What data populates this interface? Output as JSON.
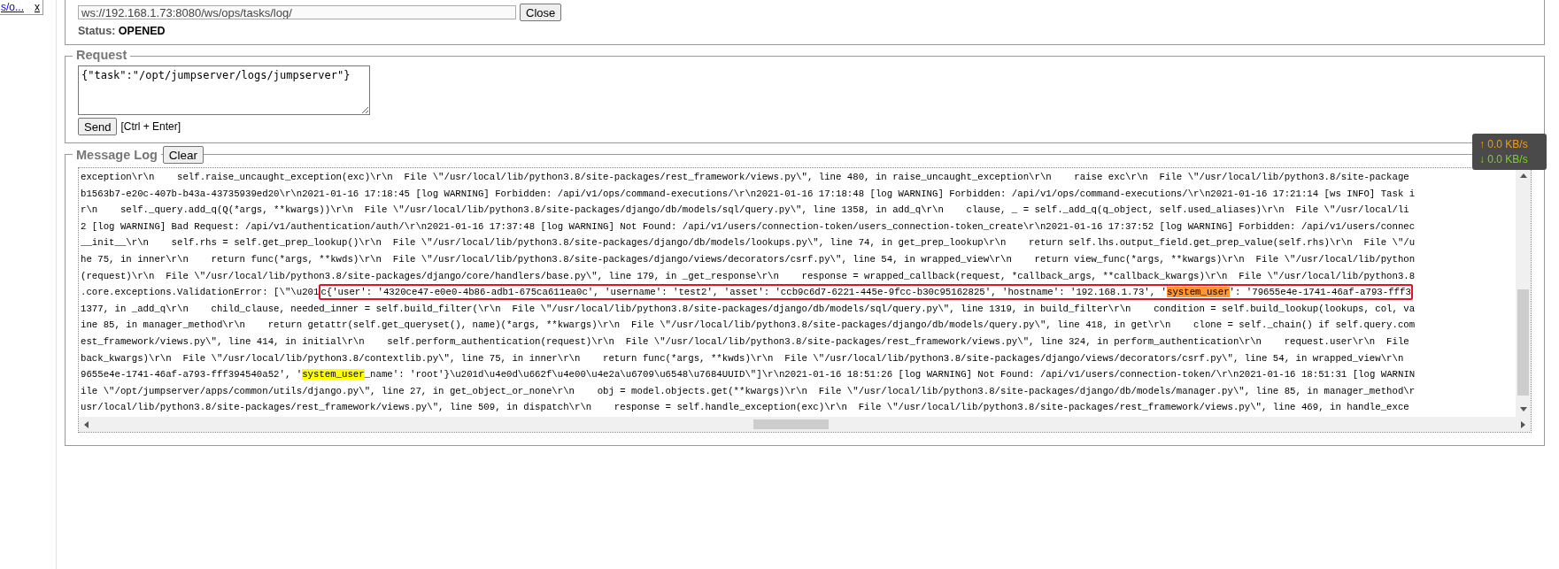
{
  "sidebar": {
    "link": "s/o...",
    "close": "x"
  },
  "connection": {
    "url": "ws://192.168.1.73:8080/ws/ops/tasks/log/",
    "button": "Close",
    "status_label": "Status:",
    "status": "OPENED"
  },
  "request": {
    "legend": "Request",
    "value": "{\"task\":\"/opt/jumpserver/logs/jumpserver\"}",
    "button": "Send",
    "hint": "[Ctrl + Enter]"
  },
  "message_log": {
    "legend": "Message Log",
    "button": "Clear",
    "lines": [
      [
        {
          "text": "exception\\r\\n    self.raise_uncaught_exception(exc)\\r\\n  File \\\"/usr/local/lib/python3.8/site-packages/rest_framework/views.py\\\", line 480, in raise_uncaught_exception\\r\\n    raise exc\\r\\n  File \\\"/usr/local/lib/python3.8/site-package"
        }
      ],
      [
        {
          "text": "b1563b7-e20c-407b-b43a-43735939ed20\\r\\n2021-01-16 17:18:45 [log WARNING] Forbidden: /api/v1/ops/command-executions/\\r\\n2021-01-16 17:18:48 [log WARNING] Forbidden: /api/v1/ops/command-executions/\\r\\n2021-01-16 17:21:14 [ws INFO] Task i"
        }
      ],
      [
        {
          "text": "r\\n    self._query.add_q(Q(*args, **kwargs))\\r\\n  File \\\"/usr/local/lib/python3.8/site-packages/django/db/models/sql/query.py\\\", line 1358, in add_q\\r\\n    clause, _ = self._add_q(q_object, self.used_aliases)\\r\\n  File \\\"/usr/local/li"
        }
      ],
      [
        {
          "text": "2 [log WARNING] Bad Request: /api/v1/authentication/auth/\\r\\n2021-01-16 17:37:48 [log WARNING] Not Found: /api/v1/users/connection-token/users_connection-token_create\\r\\n2021-01-16 17:37:52 [log WARNING] Forbidden: /api/v1/users/connec"
        }
      ],
      [
        {
          "text": "__init__\\r\\n    self.rhs = self.get_prep_lookup()\\r\\n  File \\\"/usr/local/lib/python3.8/site-packages/django/db/models/lookups.py\\\", line 74, in get_prep_lookup\\r\\n    return self.lhs.output_field.get_prep_value(self.rhs)\\r\\n  File \\\"/u"
        }
      ],
      [
        {
          "text": "he 75, in inner\\r\\n    return func(*args, **kwds)\\r\\n  File \\\"/usr/local/lib/python3.8/site-packages/django/views/decorators/csrf.py\\\", line 54, in wrapped_view\\r\\n    return view_func(*args, **kwargs)\\r\\n  File \\\"/usr/local/lib/python"
        }
      ],
      [
        {
          "text": "(request)\\r\\n  File \\\"/usr/local/lib/python3.8/site-packages/django/core/handlers/base.py\\\", line 179, in _get_response\\r\\n    response = wrapped_callback(request, *callback_args, **callback_kwargs)\\r\\n  File \\\"/usr/local/lib/python3.8"
        }
      ],
      [
        {
          "text": ".core.exceptions.ValidationError: [\\\"\\u201"
        },
        {
          "kind": "outlined",
          "parts": [
            {
              "text": "c{'user': '4320ce47-e0e0-4b86-adb1-675ca611ea0c', 'username': 'test2', 'asset': 'ccb9c6d7-6221-445e-9fcc-b30c95162825', 'hostname': '192.168.1.73', '"
            },
            {
              "text": "system_user",
              "color": "#ff9632"
            },
            {
              "text": "': '79655e4e-1741-46af-a793-fff3"
            }
          ]
        }
      ],
      [
        {
          "text": "1377, in _add_q\\r\\n    child_clause, needed_inner = self.build_filter(\\r\\n  File \\\"/usr/local/lib/python3.8/site-packages/django/db/models/sql/query.py\\\", line 1319, in build_filter\\r\\n    condition = self.build_lookup(lookups, col, va"
        }
      ],
      [
        {
          "text": "ine 85, in manager_method\\r\\n    return getattr(self.get_queryset(), name)(*args, **kwargs)\\r\\n  File \\\"/usr/local/lib/python3.8/site-packages/django/db/models/query.py\\\", line 418, in get\\r\\n    clone = self._chain() if self.query.com"
        }
      ],
      [
        {
          "text": "est_framework/views.py\\\", line 414, in initial\\r\\n    self.perform_authentication(request)\\r\\n  File \\\"/usr/local/lib/python3.8/site-packages/rest_framework/views.py\\\", line 324, in perform_authentication\\r\\n    request.user\\r\\n  File"
        }
      ],
      [
        {
          "text": "back_kwargs)\\r\\n  File \\\"/usr/local/lib/python3.8/contextlib.py\\\", line 75, in inner\\r\\n    return func(*args, **kwds)\\r\\n  File \\\"/usr/local/lib/python3.8/site-packages/django/views/decorators/csrf.py\\\", line 54, in wrapped_view\\r\\n"
        }
      ],
      [
        {
          "text": "9655e4e-1741-46af-a793-fff394540a52', '"
        },
        {
          "text": "system_user",
          "color": "#ffff00"
        },
        {
          "text": "_name': 'root'}\\u201d\\u4e0d\\u662f\\u4e00\\u4e2a\\u6709\\u6548\\u7684UUID\\\"]\\r\\n2021-01-16 18:51:26 [log WARNING] Not Found: /api/v1/users/connection-token/\\r\\n2021-01-16 18:51:31 [log WARNIN"
        }
      ],
      [
        {
          "text": "ile \\\"/opt/jumpserver/apps/common/utils/django.py\\\", line 27, in get_object_or_none\\r\\n    obj = model.objects.get(**kwargs)\\r\\n  File \\\"/usr/local/lib/python3.8/site-packages/django/db/models/manager.py\\\", line 85, in manager_method\\r"
        }
      ],
      [
        {
          "text": "usr/local/lib/python3.8/site-packages/rest_framework/views.py\\\", line 509, in dispatch\\r\\n    response = self.handle_exception(exc)\\r\\n  File \\\"/usr/local/lib/python3.8/site-packages/rest_framework/views.py\\\", line 469, in handle_exce"
        }
      ]
    ]
  },
  "net_speed": {
    "upload": "↑ 0.0 KB/s",
    "download": "↓ 0.0 KB/s"
  }
}
